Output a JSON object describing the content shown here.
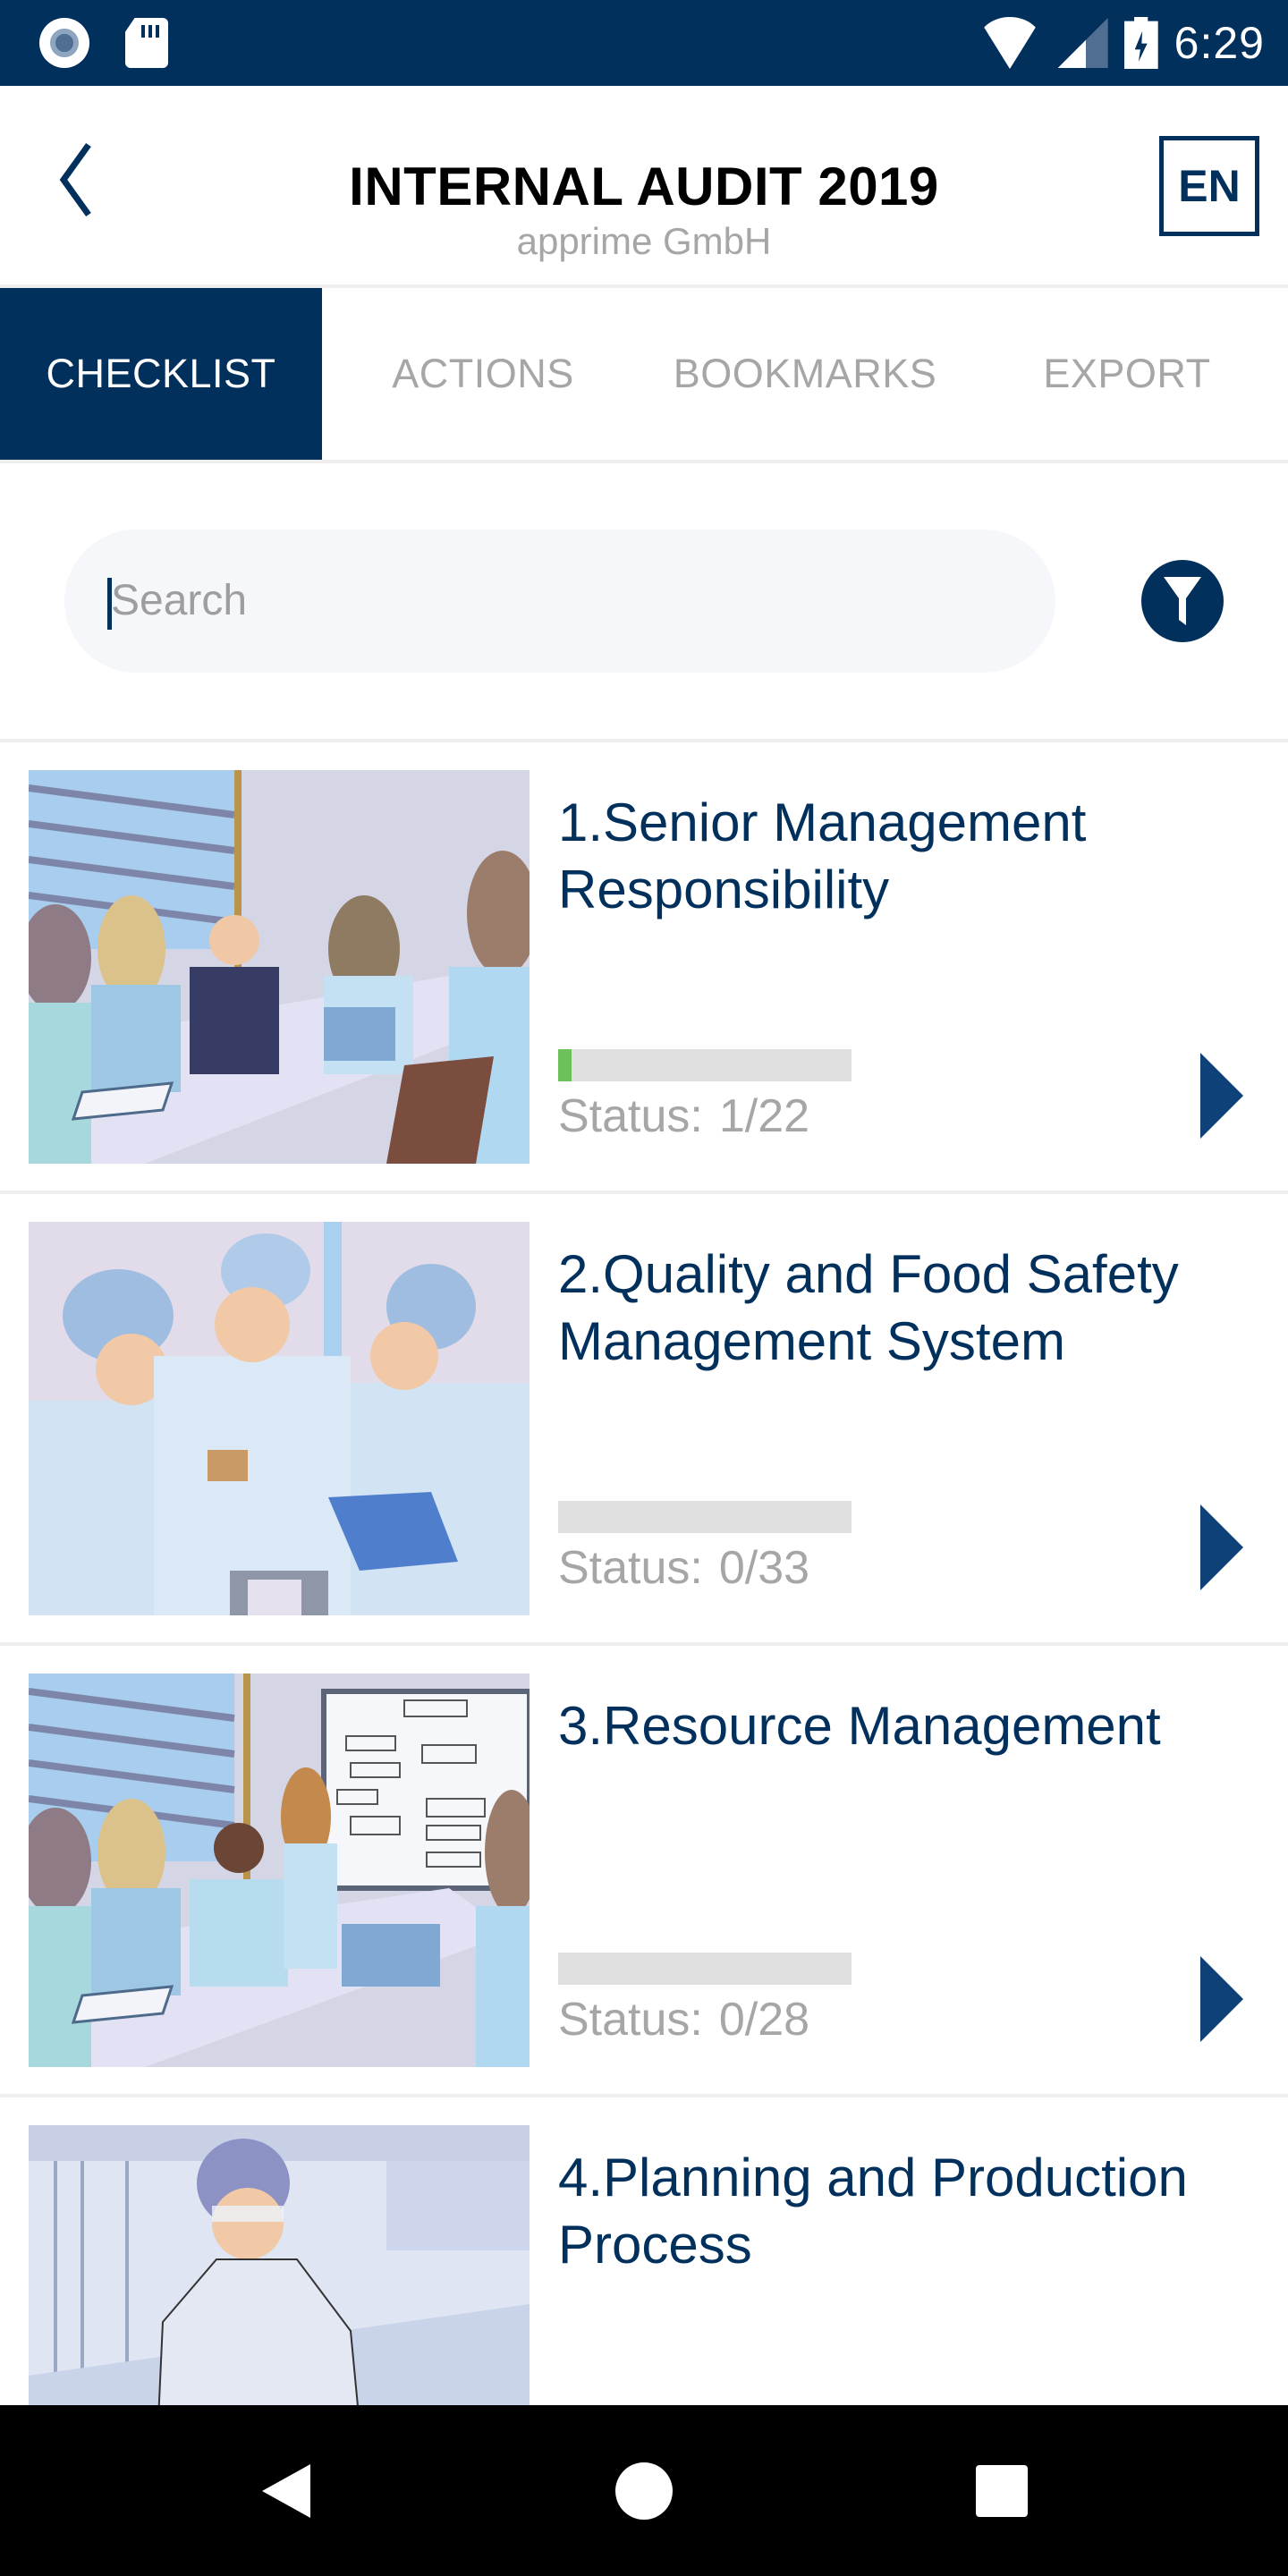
{
  "status_bar": {
    "time": "6:29",
    "icons": [
      "record-icon",
      "sd-card-icon",
      "wifi-icon",
      "cell-signal-icon",
      "battery-charging-icon"
    ]
  },
  "header": {
    "title": "INTERNAL AUDIT 2019",
    "subtitle": "apprime GmbH",
    "language": "EN",
    "back_icon": "chevron-left-icon"
  },
  "tabs": [
    {
      "label": "CHECKLIST",
      "active": true
    },
    {
      "label": "ACTIONS",
      "active": false
    },
    {
      "label": "BOOKMARKS",
      "active": false
    },
    {
      "label": "EXPORT",
      "active": false
    }
  ],
  "search": {
    "placeholder": "Search",
    "value": "",
    "filter_icon": "filter-icon"
  },
  "checklist": {
    "status_label": "Status:",
    "items": [
      {
        "title": "1.Senior Management Responsibility",
        "status": "1/22",
        "progress": 0.045,
        "image": "meeting-illustration"
      },
      {
        "title": "2.Quality and Food Safety Management System",
        "status": "0/33",
        "progress": 0,
        "image": "hygiene-team-illustration"
      },
      {
        "title": "3.Resource Management",
        "status": "0/28",
        "progress": 0,
        "image": "presentation-meeting-illustration"
      },
      {
        "title": "4.Planning and Production Process",
        "status": "",
        "progress": null,
        "image": "lab-worker-illustration"
      }
    ]
  },
  "colors": {
    "primary": "#02305c",
    "progress_fill": "#6cc15a",
    "progress_track": "#e0e0e0",
    "arrow": "#0e4178",
    "muted_text": "#a6a6a6"
  },
  "nav_bar": {
    "buttons": [
      "back",
      "home",
      "recents"
    ]
  }
}
